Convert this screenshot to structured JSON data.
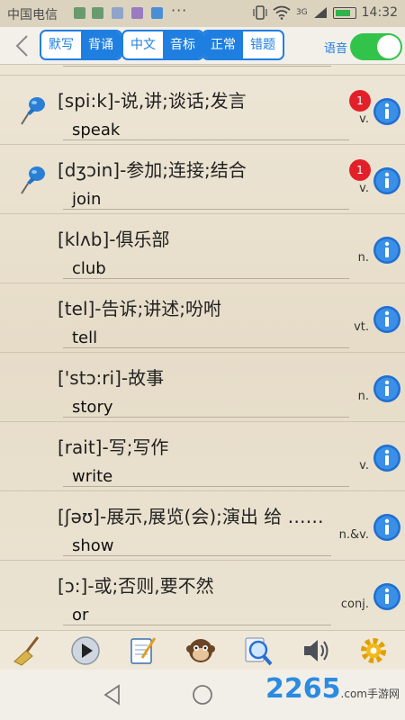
{
  "status_bar": {
    "carrier": "中国电信",
    "more": "···",
    "network": "3G",
    "time": "14:32"
  },
  "toolbar": {
    "groups": [
      {
        "items": [
          "默写",
          "背诵"
        ],
        "active": 1
      },
      {
        "items": [
          "中文",
          "音标"
        ],
        "active": 1
      },
      {
        "items": [
          "正常",
          "错题"
        ],
        "active": 0
      }
    ],
    "voice_label": "语音",
    "voice_on": true
  },
  "words": [
    {
      "def": "[spi:k]-说,讲;谈话;发言",
      "word": "speak",
      "pos": "v.",
      "badge": "1",
      "pinned": true
    },
    {
      "def": "[dʒɔin]-参加;连接;结合",
      "word": "join",
      "pos": "v.",
      "badge": "1",
      "pinned": true
    },
    {
      "def": "[klʌb]-俱乐部",
      "word": "club",
      "pos": "n.",
      "badge": "",
      "pinned": false
    },
    {
      "def": "[tel]-告诉;讲述;吩咐",
      "word": "tell",
      "pos": "vt.",
      "badge": "",
      "pinned": false
    },
    {
      "def": "['stɔ:ri]-故事",
      "word": "story",
      "pos": "n.",
      "badge": "",
      "pinned": false
    },
    {
      "def": "[rait]-写;写作",
      "word": "write",
      "pos": "v.",
      "badge": "",
      "pinned": false
    },
    {
      "def": "[ʃəʊ]-展示,展览(会);演出 给 ……",
      "word": "show",
      "pos": "n.&v.",
      "badge": "",
      "pinned": false
    },
    {
      "def": "[ɔ:]-或;否则,要不然",
      "word": "or",
      "pos": "conj.",
      "badge": "",
      "pinned": false
    }
  ],
  "bottom_tools": [
    "broom-icon",
    "play-icon",
    "notepad-icon",
    "monkey-icon",
    "magnifier-icon",
    "speaker-icon",
    "gear-icon"
  ],
  "watermark": {
    "brand": "2265",
    "suffix": ".com",
    "sub": "手游网"
  },
  "colors": {
    "accent": "#1f7fe0",
    "toggle": "#32c44a",
    "badge": "#e2202a",
    "paper": "#e9e0cf"
  }
}
